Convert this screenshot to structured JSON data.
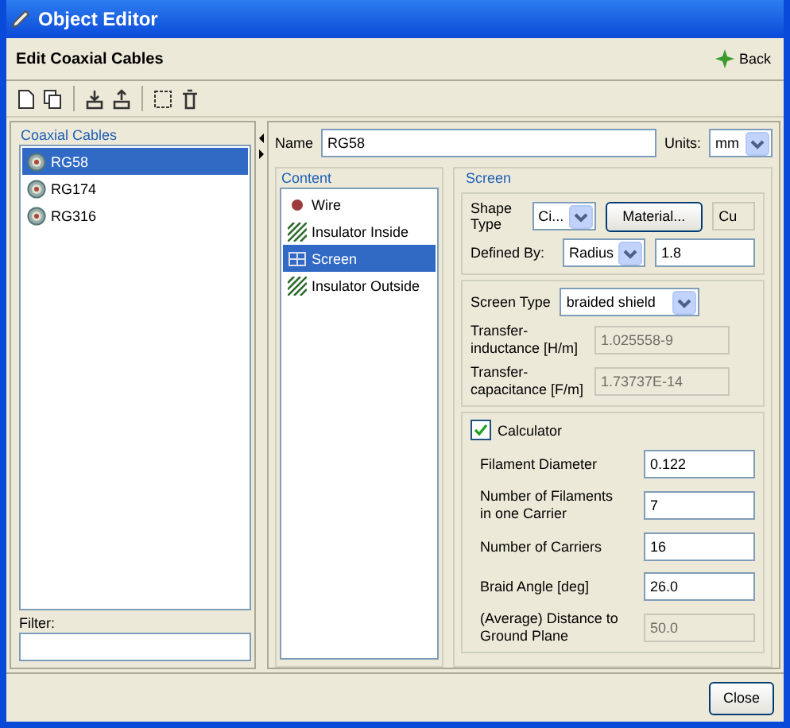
{
  "window": {
    "title": "Object Editor"
  },
  "header": {
    "title": "Edit Coaxial Cables",
    "back_button": "Back"
  },
  "cables_panel": {
    "title": "Coaxial Cables",
    "filter_label": "Filter:",
    "items": [
      {
        "label": "RG58",
        "selected": true
      },
      {
        "label": "RG174",
        "selected": false
      },
      {
        "label": "RG316",
        "selected": false
      }
    ]
  },
  "name_row": {
    "label": "Name",
    "value": "RG58",
    "units_label": "Units:",
    "units_value": "mm"
  },
  "content_panel": {
    "title": "Content",
    "items": [
      {
        "label": "Wire",
        "kind": "wire",
        "selected": false
      },
      {
        "label": "Insulator Inside",
        "kind": "insulator",
        "selected": false
      },
      {
        "label": "Screen",
        "kind": "screen",
        "selected": true
      },
      {
        "label": "Insulator Outside",
        "kind": "insulator",
        "selected": false
      }
    ]
  },
  "screen_panel": {
    "title": "Screen",
    "shape_type_label": "Shape Type",
    "shape_type_value": "Ci...",
    "material_button": "Material...",
    "material_value": "Cu",
    "defined_by_label": "Defined By:",
    "defined_by_value": "Radius",
    "defined_by_amount": "1.8",
    "screen_type_label": "Screen Type",
    "screen_type_value": "braided shield",
    "transfer_fields": [
      {
        "label": "Transfer-\ninductance [H/m]",
        "value": "1.025558-9",
        "disabled": true
      },
      {
        "label": "Transfer-\ncapacitance [F/m]",
        "value": "1.73737E-14",
        "disabled": true
      }
    ],
    "calculator": {
      "label": "Calculator",
      "checked": true,
      "fields": [
        {
          "label": "Filament Diameter",
          "value": "0.122",
          "disabled": false
        },
        {
          "label": "Number of Filaments\nin one Carrier",
          "value": "7",
          "disabled": false
        },
        {
          "label": "Number of Carriers",
          "value": "16",
          "disabled": false
        },
        {
          "label": "Braid Angle [deg]",
          "value": "26.0",
          "disabled": false
        },
        {
          "label": "(Average) Distance to\nGround Plane",
          "value": "50.0",
          "disabled": true
        }
      ]
    }
  },
  "close_button": "Close"
}
